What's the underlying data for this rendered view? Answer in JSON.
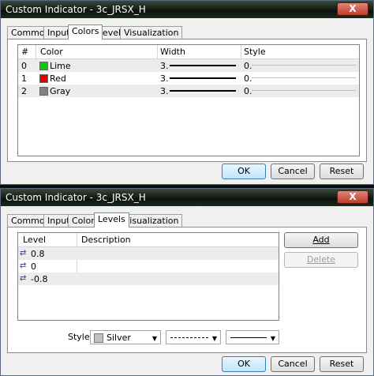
{
  "window1": {
    "title": "Custom Indicator - 3c_JRSX_H",
    "close_label": "X",
    "tabs": [
      "Common",
      "Inputs",
      "Colors",
      "Levels",
      "Visualization"
    ],
    "active_tab": "Colors",
    "columns": [
      "#",
      "Color",
      "Width",
      "Style"
    ],
    "rows": [
      {
        "num": "0",
        "color_name": "Lime",
        "color": "#00d000",
        "width": "3.",
        "style": "0."
      },
      {
        "num": "1",
        "color_name": "Red",
        "color": "#e00000",
        "width": "3.",
        "style": "0."
      },
      {
        "num": "2",
        "color_name": "Gray",
        "color": "#808080",
        "width": "3.",
        "style": "0."
      }
    ],
    "ok_label": "OK",
    "cancel_label": "Cancel",
    "reset_label": "Reset"
  },
  "window2": {
    "title": "Custom Indicator - 3c_JRSX_H",
    "close_label": "X",
    "tabs": [
      "Common",
      "Inputs",
      "Colors",
      "Levels",
      "Visualization"
    ],
    "active_tab": "Levels",
    "columns": [
      "Level",
      "Description"
    ],
    "levels": [
      {
        "value": "0.8",
        "description": ""
      },
      {
        "value": "0",
        "description": ""
      },
      {
        "value": "-0.8",
        "description": ""
      }
    ],
    "add_label": "Add",
    "delete_label": "Delete",
    "style_label": "Style:",
    "style_color_name": "Silver",
    "style_color": "#c0c0c0",
    "ok_label": "OK",
    "cancel_label": "Cancel",
    "reset_label": "Reset"
  }
}
